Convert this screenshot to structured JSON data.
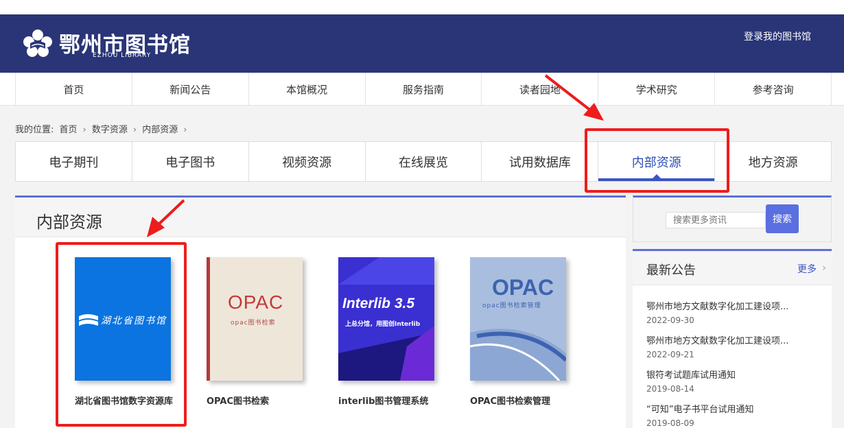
{
  "header": {
    "logo_title": "鄂州市图书馆",
    "logo_subtitle": "EZHOU LIBRARY",
    "login_label": "登录我的图书馆"
  },
  "main_nav": [
    "首页",
    "新闻公告",
    "本馆概况",
    "服务指南",
    "读者园地",
    "学术研究",
    "参考咨询"
  ],
  "breadcrumb": {
    "prefix": "我的位置:",
    "items": [
      "首页",
      "数字资源",
      "内部资源"
    ]
  },
  "sub_nav": {
    "items": [
      "电子期刊",
      "电子图书",
      "视频资源",
      "在线展览",
      "试用数据库",
      "内部资源",
      "地方资源"
    ],
    "active": "内部资源"
  },
  "content": {
    "title": "内部资源",
    "cards": [
      {
        "label": "湖北省图书馆数字资源库",
        "cover_text": "湖北省图书馆"
      },
      {
        "label": "OPAC图书检索",
        "cover_text": "OPAC",
        "cover_sub": "opac图书检索"
      },
      {
        "label": "interlib图书管理系统",
        "cover_text": "Interlib 3.5",
        "cover_sub": "上总分馆，用图创Interlib"
      },
      {
        "label": "OPAC图书检索管理",
        "cover_text": "OPAC",
        "cover_sub": "opac图书检索管理"
      }
    ]
  },
  "sidebar": {
    "search_placeholder": "搜索更多资讯",
    "search_button": "搜索",
    "notice_title": "最新公告",
    "more_label": "更多",
    "notices": [
      {
        "title": "鄂州市地方文献数字化加工建设项...",
        "date": "2022-09-30"
      },
      {
        "title": "鄂州市地方文献数字化加工建设项...",
        "date": "2022-09-21"
      },
      {
        "title": "银符考试题库试用通知",
        "date": "2019-08-14"
      },
      {
        "title": "“可知”电子书平台试用通知",
        "date": "2019-08-09"
      }
    ]
  },
  "colors": {
    "header_bg": "#2a3577",
    "accent": "#3a54c4",
    "highlight_red": "#ee1c1c"
  }
}
